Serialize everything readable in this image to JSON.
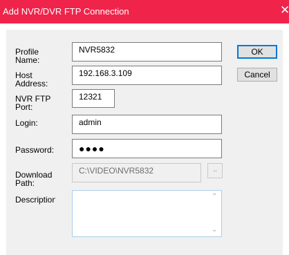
{
  "dialog": {
    "title": "Add NVR/DVR FTP Connection",
    "close_glyph": "✕"
  },
  "labels": {
    "profile_name": "Profile Name:",
    "host_address": "Host Address:",
    "nvr_ftp_port": "NVR FTP Port:",
    "login": "Login:",
    "password": "Password:",
    "download_path": "Download Path:",
    "description": "Description:"
  },
  "fields": {
    "profile_name": "NVR5832",
    "host_address": "192.168.3.109",
    "nvr_ftp_port": "12321",
    "login": "admin",
    "password_mask": "●●●●",
    "download_path": "C:\\VIDEO\\NVR5832",
    "description": ""
  },
  "buttons": {
    "ok": "OK",
    "cancel": "Cancel",
    "browse": ".."
  },
  "icons": {
    "close": "close-icon",
    "scroll_up": "chevron-up-icon",
    "scroll_down": "chevron-down-icon"
  },
  "colors": {
    "titlebar": "#f0234a",
    "client_bg": "#f0f0f0",
    "default_button_border": "#0078d7"
  }
}
